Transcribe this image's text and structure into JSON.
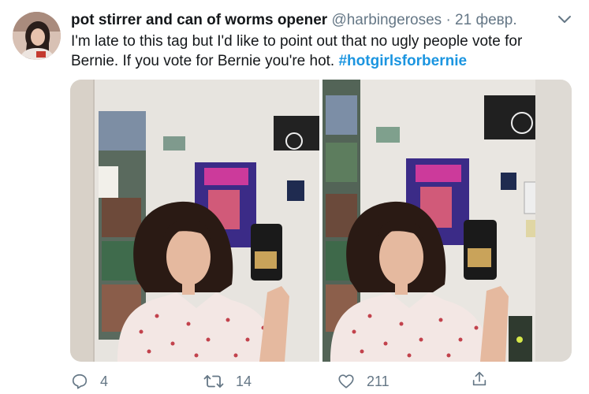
{
  "tweet": {
    "display_name": "pot stirrer and can of worms opener",
    "handle": "@harbingeroses",
    "separator": "·",
    "date": "21 февр.",
    "text_before": "I'm late to this tag but I'd like to point out that no ugly people vote for Bernie. If you vote for Bernie you're hot. ",
    "hashtag": "#hotgirlsforbernie"
  },
  "actions": {
    "reply_count": "4",
    "retweet_count": "14",
    "like_count": "211"
  },
  "media": {
    "photo_count": 2
  },
  "colors": {
    "link": "#1b95e0",
    "secondary_text": "#657786",
    "primary_text": "#14171a"
  }
}
